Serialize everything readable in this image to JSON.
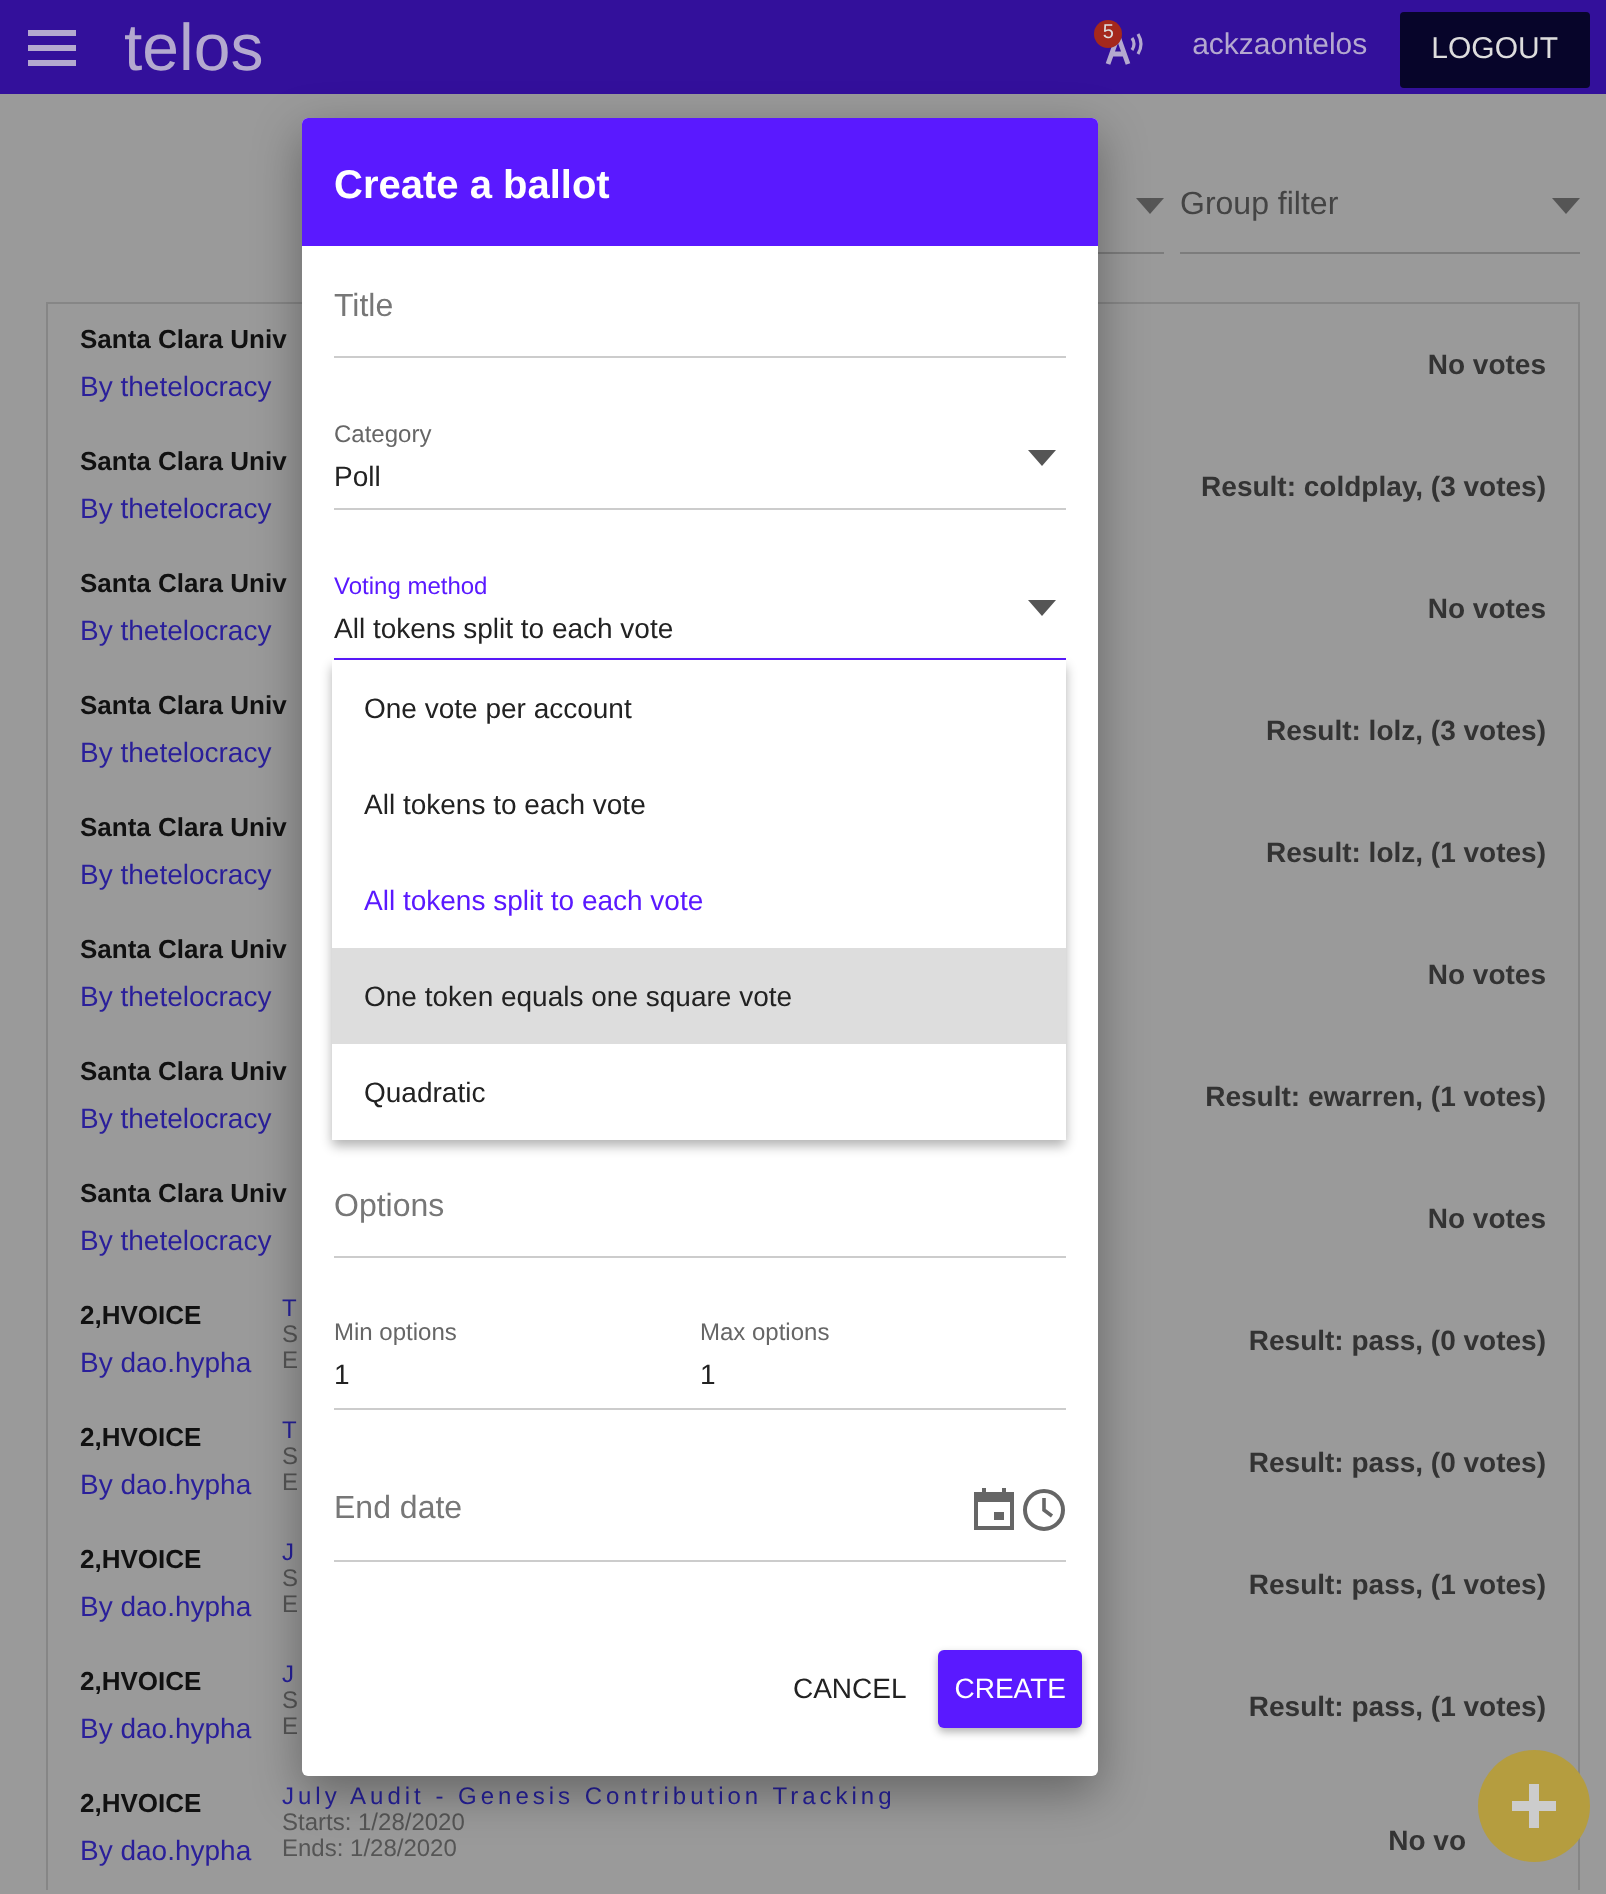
{
  "navbar": {
    "logo": "telos",
    "notification_count": "5",
    "username": "ackzaontelos",
    "logout": "LOGOUT"
  },
  "filters": [
    {
      "kind": "select"
    },
    {
      "kind": "select",
      "label": "Group filter"
    }
  ],
  "ballots": [
    {
      "group": "Santa Clara Univ",
      "author": "By thetelocracy",
      "result": "No votes"
    },
    {
      "group": "Santa Clara Univ",
      "author": "By thetelocracy",
      "result": "Result: coldplay, (3 votes)"
    },
    {
      "group": "Santa Clara Univ",
      "author": "By thetelocracy",
      "result": "No votes"
    },
    {
      "group": "Santa Clara Univ",
      "author": "By thetelocracy",
      "result": "Result: lolz, (3 votes)"
    },
    {
      "group": "Santa Clara Univ",
      "author": "By thetelocracy",
      "result": "Result: lolz, (1 votes)"
    },
    {
      "group": "Santa Clara Univ",
      "author": "By thetelocracy",
      "result": "No votes"
    },
    {
      "group": "Santa Clara Univ",
      "author": "By thetelocracy",
      "result": "Result: ewarren, (1 votes)"
    },
    {
      "group": "Santa Clara Univ",
      "author": "By thetelocracy",
      "result": "No votes"
    },
    {
      "group": "2,HVOICE",
      "author": "By dao.hypha",
      "title": "T",
      "starts": "S",
      "ends": "E",
      "result": "Result: pass, (0 votes)"
    },
    {
      "group": "2,HVOICE",
      "author": "By dao.hypha",
      "title": "T",
      "starts": "S",
      "ends": "E",
      "result": "Result: pass, (0 votes)"
    },
    {
      "group": "2,HVOICE",
      "author": "By dao.hypha",
      "title": "J",
      "starts": "S",
      "ends": "E",
      "result": "Result: pass, (1 votes)"
    },
    {
      "group": "2,HVOICE",
      "author": "By dao.hypha",
      "title": "J",
      "starts": "S",
      "ends": "E",
      "result": "Result: pass, (1 votes)"
    },
    {
      "group": "2,HVOICE",
      "author": "By dao.hypha",
      "title": "July Audit - Genesis Contribution Tracking",
      "starts": "Starts: 1/28/2020",
      "ends": "Ends: 1/28/2020",
      "result": "No vo"
    }
  ],
  "modal": {
    "title": "Create a ballot",
    "fields": [
      {
        "kind": "text",
        "label": "Title"
      },
      {
        "kind": "select",
        "label": "Category",
        "value": "Poll",
        "focused": false
      },
      {
        "kind": "select",
        "label": "Voting method",
        "value": "All tokens split to each vote",
        "focused": true
      }
    ],
    "menu": [
      {
        "label": "One vote per account",
        "selected": false,
        "highlighted": false
      },
      {
        "label": "All tokens to each vote",
        "selected": false,
        "highlighted": false
      },
      {
        "label": "All tokens split to each vote",
        "selected": true,
        "highlighted": false
      },
      {
        "label": "One token equals one square vote",
        "selected": false,
        "highlighted": true
      },
      {
        "label": "Quadratic",
        "selected": false,
        "highlighted": false
      }
    ],
    "options_label": "Options",
    "min_options": {
      "label": "Min options",
      "value": "1"
    },
    "max_options": {
      "label": "Max options",
      "value": "1"
    },
    "end_date": {
      "label": "End date"
    },
    "buttons": [
      {
        "kind": "text",
        "label": "CANCEL"
      },
      {
        "kind": "primary",
        "label": "CREATE"
      }
    ]
  }
}
